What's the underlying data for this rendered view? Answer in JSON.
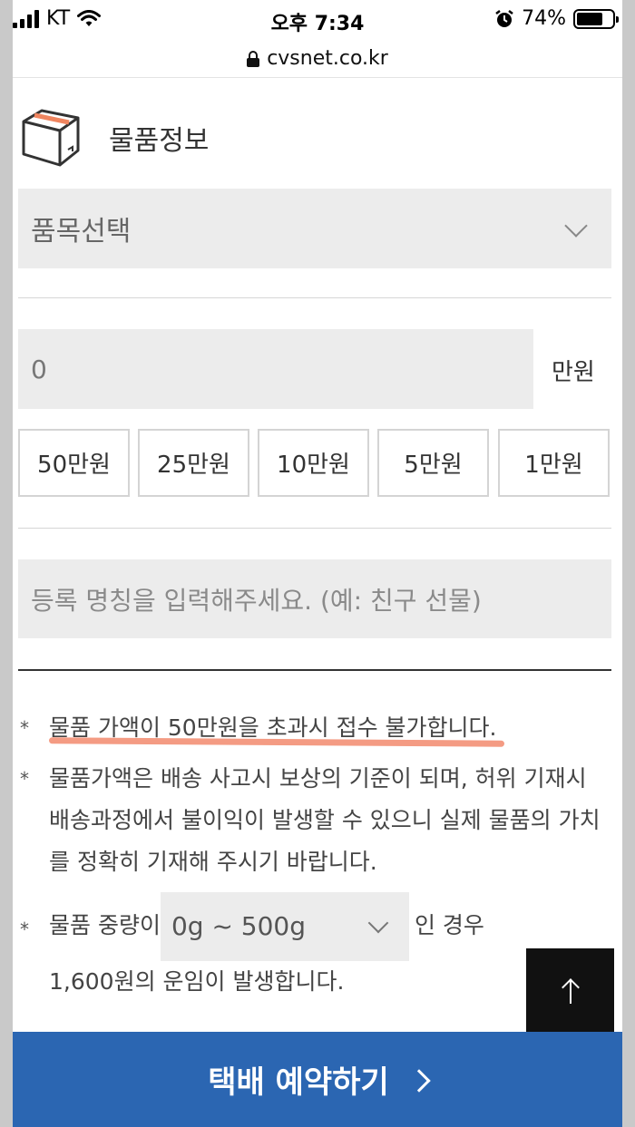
{
  "status_bar": {
    "carrier": "KT",
    "time": "오후 7:34",
    "battery": "74%",
    "battery_level": 0.74
  },
  "url": "cvsnet.co.kr",
  "section": {
    "title": "물품정보",
    "icon": "box-icon"
  },
  "item_select": {
    "value": "품목선택"
  },
  "amount": {
    "value": "0",
    "unit": "만원",
    "quick_buttons": [
      "50만원",
      "25만원",
      "10만원",
      "5만원",
      "1만원"
    ]
  },
  "name_input": {
    "placeholder": "등록 명칭을 입력해주세요. (예: 친구 선물)"
  },
  "notes": {
    "star": "*",
    "note1": "물품 가액이 50만원을 초과시 접수 불가합니다.",
    "note2": "물품가액은 배송 사고시 보상의 기준이 되며, 허위 기재시 배송과정에서 불이익이 발생할 수 있으니 실제 물품의 가치를 정확히 기재해 주시기 바랍니다.",
    "note3_prefix": "물품 중량이",
    "weight_select": "0g ~ 500g",
    "note3_suffix": "인 경우",
    "note3_line2": "1,600원의 운임이 발생합니다."
  },
  "top_button": {
    "icon": "arrow-up-icon"
  },
  "reserve_button": {
    "label": "택배 예약하기"
  },
  "colors": {
    "primary": "#2b66b2",
    "input_bg": "#ececec",
    "highlight": "#f49b83"
  }
}
